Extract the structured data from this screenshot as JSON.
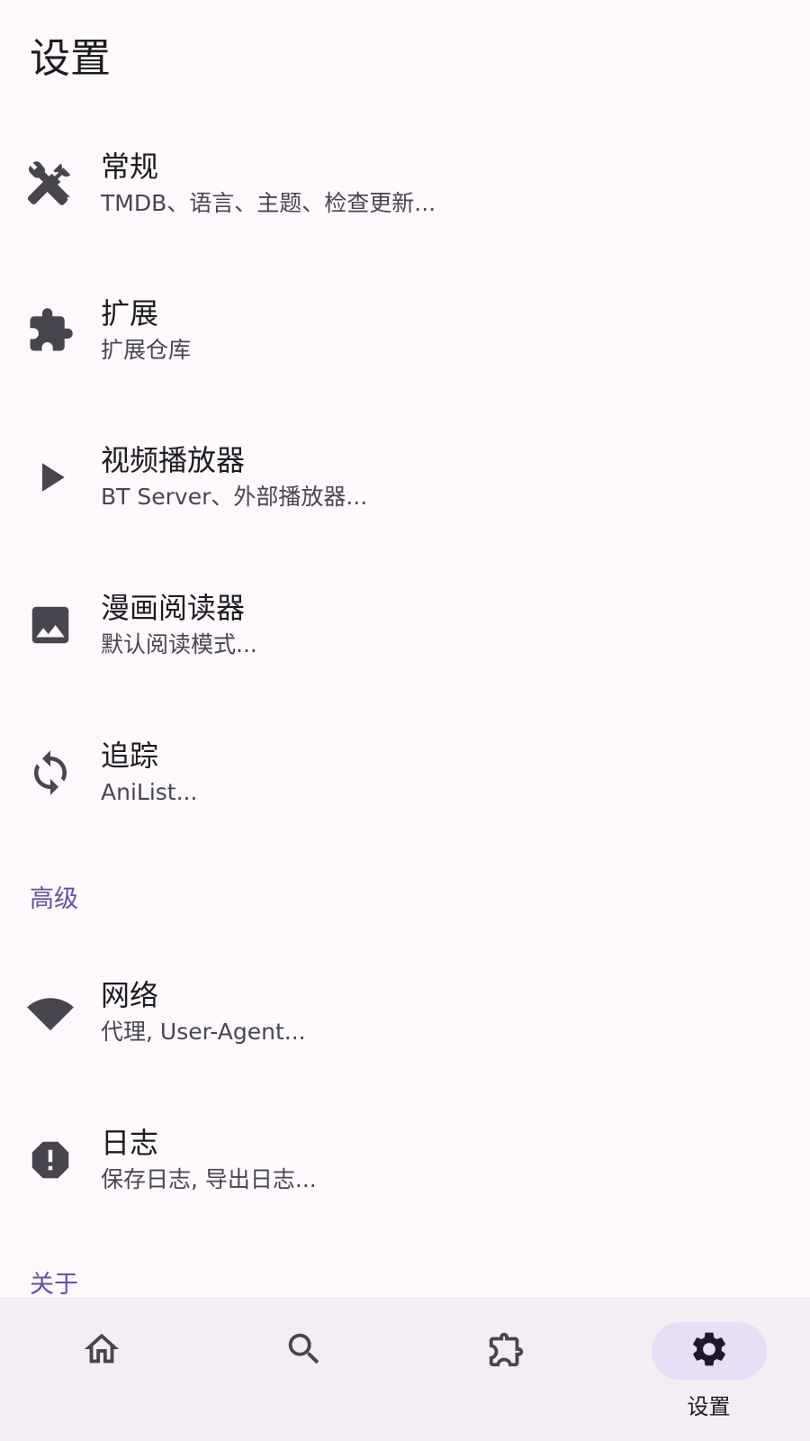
{
  "page": {
    "title": "设置"
  },
  "items": [
    {
      "label": "常规",
      "desc": "TMDB、语言、主题、检查更新...",
      "icon": "tools-icon"
    },
    {
      "label": "扩展",
      "desc": "扩展仓库",
      "icon": "puzzle-icon"
    },
    {
      "label": "视频播放器",
      "desc": "BT Server、外部播放器...",
      "icon": "play-icon"
    },
    {
      "label": "漫画阅读器",
      "desc": "默认阅读模式...",
      "icon": "image-icon"
    },
    {
      "label": "追踪",
      "desc": "AniList...",
      "icon": "sync-icon"
    },
    {
      "label": "网络",
      "desc": "代理, User-Agent...",
      "icon": "wifi-icon"
    },
    {
      "label": "日志",
      "desc": "保存日志, 导出日志...",
      "icon": "alert-octagon-icon"
    }
  ],
  "sections": {
    "advanced": "高级",
    "about": "关于"
  },
  "nav": {
    "items": [
      {
        "icon": "home-icon",
        "label": ""
      },
      {
        "icon": "search-icon",
        "label": ""
      },
      {
        "icon": "puzzle-outline-icon",
        "label": ""
      },
      {
        "icon": "gear-icon",
        "label": "设置"
      }
    ],
    "active_index": 3
  },
  "colors": {
    "accent": "#6750a4",
    "background": "#fdf9fd",
    "nav_background": "#f2eef4",
    "active_pill": "#e8def8"
  }
}
